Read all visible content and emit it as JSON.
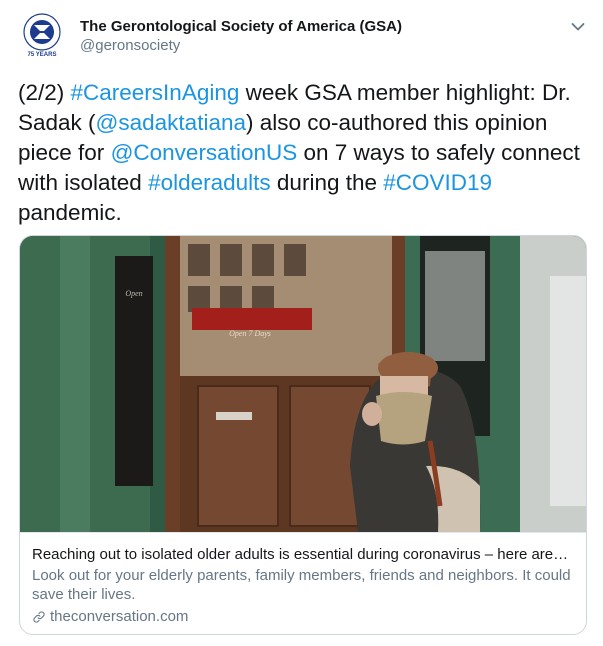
{
  "author": {
    "name": "The Gerontological Society of America (GSA)",
    "handle": "@geronsociety",
    "avatar_text": "75 YEARS"
  },
  "colors": {
    "link": "#1b95e0",
    "avatar_blue": "#1d3c8f",
    "border": "#ccd6dd",
    "secondary_text": "#657786"
  },
  "tweet": {
    "t0": "(2/2) ",
    "h1": "#CareersInAging",
    "t1": " week GSA member highlight: Dr. Sadak (",
    "m1": "@sadaktatiana",
    "t2": ") also co-authored this opinion piece for ",
    "m2": "@ConversationUS",
    "t3": " on 7 ways to safely  connect with isolated ",
    "h2": "#olderadults",
    "t4": " during the ",
    "h3": "#COVID19",
    "t5": " pandemic."
  },
  "card": {
    "title": "Reaching out to isolated older adults is essential during coronavirus – here are…",
    "description": "Look out for your elderly parents, family members, friends and neighbors. It could save their lives.",
    "domain": "theconversation.com",
    "image_sign_text": "Open 7 Days",
    "link_icon": "link-icon"
  },
  "icons": {
    "menu": "chevron-down-icon",
    "avatar": "gsa-logo-icon"
  }
}
